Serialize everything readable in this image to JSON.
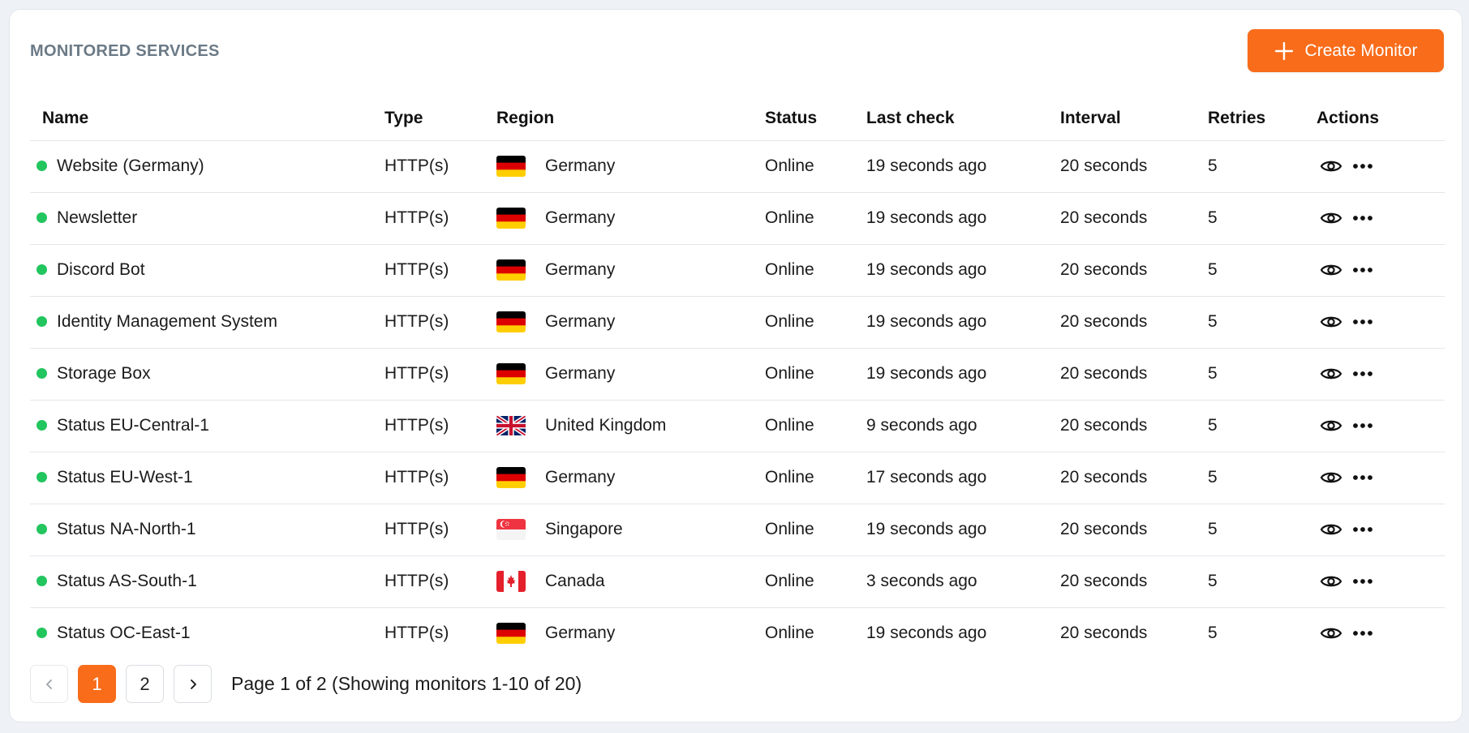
{
  "card": {
    "title": "MONITORED SERVICES",
    "create_button_label": "Create Monitor"
  },
  "colors": {
    "accent": "#f86c1a",
    "status_online": "#22c55e",
    "title_gray": "#6b7a86"
  },
  "table": {
    "headers": {
      "name": "Name",
      "type": "Type",
      "region": "Region",
      "status": "Status",
      "last_check": "Last check",
      "interval": "Interval",
      "retries": "Retries",
      "actions": "Actions"
    },
    "rows": [
      {
        "name": "Website (Germany)",
        "type": "HTTP(s)",
        "flag": "de-flag-icon",
        "region": "Germany",
        "status": "Online",
        "last_check": "19 seconds ago",
        "interval": "20 seconds",
        "retries": "5"
      },
      {
        "name": "Newsletter",
        "type": "HTTP(s)",
        "flag": "de-flag-icon",
        "region": "Germany",
        "status": "Online",
        "last_check": "19 seconds ago",
        "interval": "20 seconds",
        "retries": "5"
      },
      {
        "name": "Discord Bot",
        "type": "HTTP(s)",
        "flag": "de-flag-icon",
        "region": "Germany",
        "status": "Online",
        "last_check": "19 seconds ago",
        "interval": "20 seconds",
        "retries": "5"
      },
      {
        "name": "Identity Management System",
        "type": "HTTP(s)",
        "flag": "de-flag-icon",
        "region": "Germany",
        "status": "Online",
        "last_check": "19 seconds ago",
        "interval": "20 seconds",
        "retries": "5"
      },
      {
        "name": "Storage Box",
        "type": "HTTP(s)",
        "flag": "de-flag-icon",
        "region": "Germany",
        "status": "Online",
        "last_check": "19 seconds ago",
        "interval": "20 seconds",
        "retries": "5"
      },
      {
        "name": "Status EU-Central-1",
        "type": "HTTP(s)",
        "flag": "uk-flag-icon",
        "region": "United Kingdom",
        "status": "Online",
        "last_check": "9 seconds ago",
        "interval": "20 seconds",
        "retries": "5"
      },
      {
        "name": "Status EU-West-1",
        "type": "HTTP(s)",
        "flag": "de-flag-icon",
        "region": "Germany",
        "status": "Online",
        "last_check": "17 seconds ago",
        "interval": "20 seconds",
        "retries": "5"
      },
      {
        "name": "Status NA-North-1",
        "type": "HTTP(s)",
        "flag": "sg-flag-icon",
        "region": "Singapore",
        "status": "Online",
        "last_check": "19 seconds ago",
        "interval": "20 seconds",
        "retries": "5"
      },
      {
        "name": "Status AS-South-1",
        "type": "HTTP(s)",
        "flag": "ca-flag-icon",
        "region": "Canada",
        "status": "Online",
        "last_check": "3 seconds ago",
        "interval": "20 seconds",
        "retries": "5"
      },
      {
        "name": "Status OC-East-1",
        "type": "HTTP(s)",
        "flag": "de-flag-icon",
        "region": "Germany",
        "status": "Online",
        "last_check": "19 seconds ago",
        "interval": "20 seconds",
        "retries": "5"
      }
    ]
  },
  "pagination": {
    "pages": [
      "1",
      "2"
    ],
    "current": "1",
    "info": "Page 1 of 2 (Showing monitors 1-10 of 20)"
  }
}
